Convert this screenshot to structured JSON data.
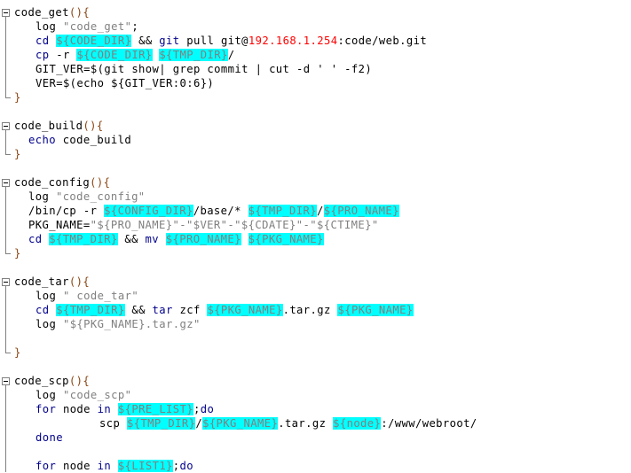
{
  "editor": {
    "lines": [
      {
        "text_parts": [
          [
            "plain",
            "code_get"
          ],
          [
            "brk",
            "(){"
          ]
        ]
      },
      {
        "text_parts": [
          [
            "plain",
            "log "
          ],
          [
            "str",
            "\"code_get\""
          ],
          [
            "plain",
            ";"
          ]
        ]
      },
      {
        "text_parts": [
          [
            "cmd",
            "cd "
          ],
          [
            "var",
            "${CODE_DIR}"
          ],
          [
            "plain",
            " && "
          ],
          [
            "cmd",
            "git"
          ],
          [
            "plain",
            " pull git@"
          ],
          [
            "ip",
            "192.168.1.254"
          ],
          [
            "plain",
            ":code/web.git"
          ]
        ]
      },
      {
        "text_parts": [
          [
            "cmd",
            "cp"
          ],
          [
            "plain",
            " -r "
          ],
          [
            "var",
            "${CODE_DIR}"
          ],
          [
            "plain",
            " "
          ],
          [
            "var",
            "${TMP_DIR}"
          ],
          [
            "plain",
            "/"
          ]
        ]
      },
      {
        "text_parts": [
          [
            "plain",
            "GIT_VER=$(git show| grep commit | cut -d ' ' -f2)"
          ]
        ]
      },
      {
        "text_parts": [
          [
            "plain",
            "VER=$(echo ${GIT_VER:0:6})"
          ]
        ]
      },
      {
        "text_parts": [
          [
            "brk",
            "}"
          ]
        ]
      },
      {
        "text_parts": []
      },
      {
        "text_parts": [
          [
            "plain",
            "code_build"
          ],
          [
            "brk",
            "(){"
          ]
        ]
      },
      {
        "text_parts": [
          [
            "cmd",
            "echo"
          ],
          [
            "plain",
            " code_build"
          ]
        ]
      },
      {
        "text_parts": [
          [
            "brk",
            "}"
          ]
        ]
      },
      {
        "text_parts": []
      },
      {
        "text_parts": [
          [
            "plain",
            "code_config"
          ],
          [
            "brk",
            "(){"
          ]
        ]
      },
      {
        "text_parts": [
          [
            "plain",
            "log "
          ],
          [
            "str",
            "\"code_config\""
          ]
        ]
      },
      {
        "text_parts": [
          [
            "plain",
            "/bin/cp -r "
          ],
          [
            "var",
            "${CONFIG_DIR}"
          ],
          [
            "plain",
            "/base/* "
          ],
          [
            "var",
            "${TMP_DIR}"
          ],
          [
            "plain",
            "/"
          ],
          [
            "var",
            "${PRO_NAME}"
          ]
        ]
      },
      {
        "text_parts": [
          [
            "plain",
            "PKG_NAME="
          ],
          [
            "str",
            "\"${PRO_NAME}\"-\"$VER\"-\"${CDATE}\"-\"${CTIME}\""
          ]
        ]
      },
      {
        "text_parts": [
          [
            "cmd",
            "cd "
          ],
          [
            "var",
            "${TMP_DIR}"
          ],
          [
            "plain",
            " && "
          ],
          [
            "cmd",
            "mv"
          ],
          [
            "plain",
            " "
          ],
          [
            "var",
            "${PRO_NAME}"
          ],
          [
            "plain",
            " "
          ],
          [
            "var",
            "${PKG_NAME}"
          ]
        ]
      },
      {
        "text_parts": [
          [
            "brk",
            "}"
          ]
        ]
      },
      {
        "text_parts": []
      },
      {
        "text_parts": [
          [
            "plain",
            "code_tar"
          ],
          [
            "brk",
            "(){"
          ]
        ]
      },
      {
        "text_parts": [
          [
            "plain",
            "log "
          ],
          [
            "str",
            "\" code_tar\""
          ]
        ]
      },
      {
        "text_parts": [
          [
            "cmd",
            "cd "
          ],
          [
            "var",
            "${TMP_DIR}"
          ],
          [
            "plain",
            " && "
          ],
          [
            "cmd",
            "tar"
          ],
          [
            "plain",
            " zcf "
          ],
          [
            "var",
            "${PKG_NAME}"
          ],
          [
            "plain",
            ".tar.gz "
          ],
          [
            "var",
            "${PKG_NAME}"
          ]
        ]
      },
      {
        "text_parts": [
          [
            "plain",
            "log "
          ],
          [
            "str",
            "\"${PKG_NAME}.tar.gz\""
          ]
        ]
      },
      {
        "text_parts": []
      },
      {
        "text_parts": [
          [
            "brk",
            "}"
          ]
        ]
      },
      {
        "text_parts": []
      },
      {
        "text_parts": [
          [
            "plain",
            "code_scp"
          ],
          [
            "brk",
            "(){"
          ]
        ]
      },
      {
        "text_parts": [
          [
            "plain",
            "log "
          ],
          [
            "str",
            "\"code_scp\""
          ]
        ]
      },
      {
        "text_parts": [
          [
            "kw",
            "for"
          ],
          [
            "plain",
            " node "
          ],
          [
            "kw",
            "in"
          ],
          [
            "plain",
            " "
          ],
          [
            "var",
            "${PRE_LIST}"
          ],
          [
            "plain",
            ";"
          ],
          [
            "kw",
            "do"
          ]
        ]
      },
      {
        "text_parts": [
          [
            "plain",
            "scp "
          ],
          [
            "var",
            "${TMP_DIR}"
          ],
          [
            "plain",
            "/"
          ],
          [
            "var",
            "${PKG_NAME}"
          ],
          [
            "plain",
            ".tar.gz "
          ],
          [
            "var",
            "${node}"
          ],
          [
            "plain",
            ":/www/webroot/"
          ]
        ]
      },
      {
        "text_parts": [
          [
            "kw",
            "done"
          ]
        ]
      },
      {
        "text_parts": []
      },
      {
        "text_parts": [
          [
            "kw",
            "for"
          ],
          [
            "plain",
            " node "
          ],
          [
            "kw",
            "in"
          ],
          [
            "plain",
            " "
          ],
          [
            "var",
            "${LIST1}"
          ],
          [
            "plain",
            ";"
          ],
          [
            "kw",
            "do"
          ]
        ]
      }
    ]
  }
}
